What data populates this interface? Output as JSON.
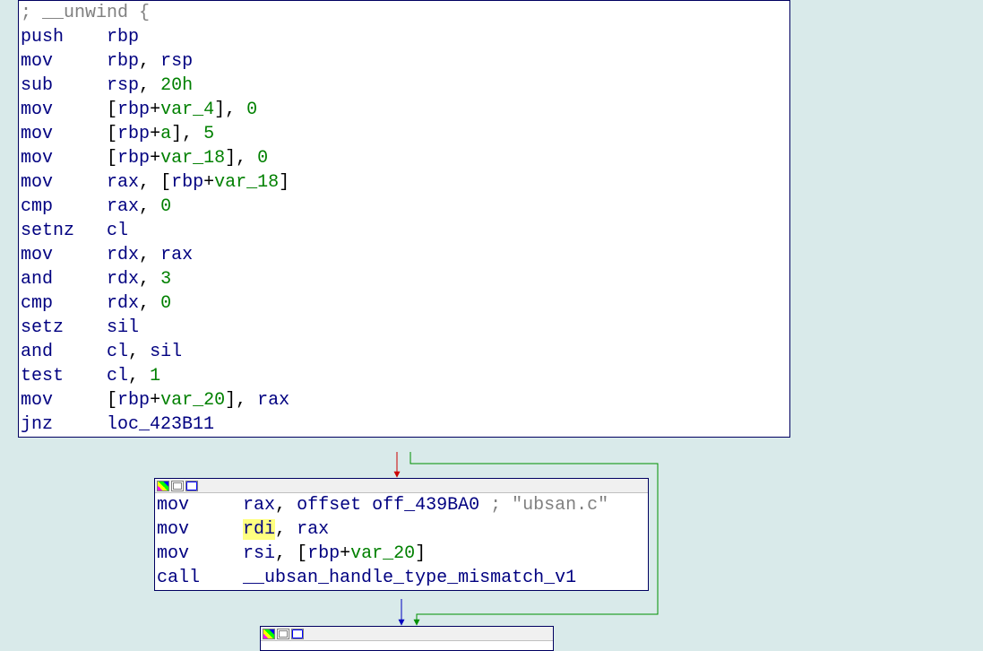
{
  "node1": {
    "l0_c0": "; __unwind {",
    "l1_m": "push",
    "l1_r1": "rbp",
    "l2_m": "mov",
    "l2_r1": "rbp",
    "l2_r2": "rsp",
    "l3_m": "sub",
    "l3_r1": "rsp",
    "l3_n": "20h",
    "l4_m": "mov",
    "l4_b1": "[",
    "l4_r1": "rbp",
    "l4_p": "+",
    "l4_v": "var_4",
    "l4_b2": "], ",
    "l4_n": "0",
    "l5_m": "mov",
    "l5_b1": "[",
    "l5_r1": "rbp",
    "l5_p": "+",
    "l5_v": "a",
    "l5_b2": "], ",
    "l5_n": "5",
    "l6_m": "mov",
    "l6_b1": "[",
    "l6_r1": "rbp",
    "l6_p": "+",
    "l6_v": "var_18",
    "l6_b2": "], ",
    "l6_n": "0",
    "l7_m": "mov",
    "l7_r1": "rax",
    "l7_b1": ", [",
    "l7_r2": "rbp",
    "l7_p": "+",
    "l7_v": "var_18",
    "l7_b2": "]",
    "l8_m": "cmp",
    "l8_r1": "rax",
    "l8_n": "0",
    "l9_m": "setnz",
    "l9_r1": "cl",
    "l10_m": "mov",
    "l10_r1": "rdx",
    "l10_r2": "rax",
    "l11_m": "and",
    "l11_r1": "rdx",
    "l11_n": "3",
    "l12_m": "cmp",
    "l12_r1": "rdx",
    "l12_n": "0",
    "l13_m": "setz",
    "l13_r1": "sil",
    "l14_m": "and",
    "l14_r1": "cl",
    "l14_r2": "sil",
    "l15_m": "test",
    "l15_r1": "cl",
    "l15_n": "1",
    "l16_m": "mov",
    "l16_b1": "[",
    "l16_r1": "rbp",
    "l16_p": "+",
    "l16_v": "var_20",
    "l16_b2": "], ",
    "l16_r2": "rax",
    "l17_m": "jnz",
    "l17_loc": "loc_423B11"
  },
  "node2": {
    "l0_m": "mov",
    "l0_r1": "rax",
    "l0_off": "offset off_439BA0",
    "l0_cmt": " ; \"ubsan.c\"",
    "l1_m": "mov",
    "l1_r1": "rdi",
    "l1_r2": "rax",
    "l2_m": "mov",
    "l2_r1": "rsi",
    "l2_b1": ", [",
    "l2_r2": "rbp",
    "l2_p": "+",
    "l2_v": "var_20",
    "l2_b2": "]",
    "l3_m": "call",
    "l3_fn": "__ubsan_handle_type_mismatch_v1"
  }
}
